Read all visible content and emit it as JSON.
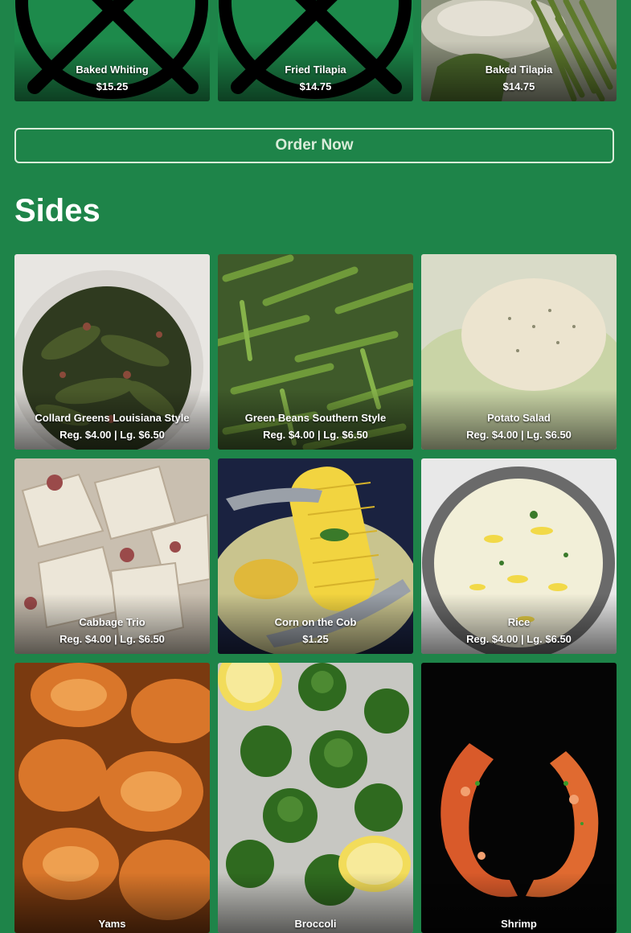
{
  "top_items": [
    {
      "name": "Baked Whiting",
      "price": "$15.25"
    },
    {
      "name": "Fried Tilapia",
      "price": "$14.75"
    },
    {
      "name": "Baked Tilapia",
      "price": "$14.75"
    }
  ],
  "order_button_label": "Order Now",
  "sides_title": "Sides",
  "sides": [
    {
      "name": "Collard Greens Louisiana Style",
      "price": "Reg. $4.00 | Lg. $6.50"
    },
    {
      "name": "Green Beans Southern Style",
      "price": "Reg. $4.00 | Lg. $6.50"
    },
    {
      "name": "Potato Salad",
      "price": "Reg. $4.00 | Lg. $6.50"
    },
    {
      "name": "Cabbage Trio",
      "price": "Reg. $4.00 | Lg. $6.50"
    },
    {
      "name": "Corn on the Cob",
      "price": "$1.25"
    },
    {
      "name": "Rice",
      "price": "Reg. $4.00 | Lg. $6.50"
    },
    {
      "name": "Yams"
    },
    {
      "name": "Broccoli"
    },
    {
      "name": "Shrimp"
    }
  ],
  "colors": {
    "background": "#1e8449",
    "button_border": "#d9ecd9"
  }
}
